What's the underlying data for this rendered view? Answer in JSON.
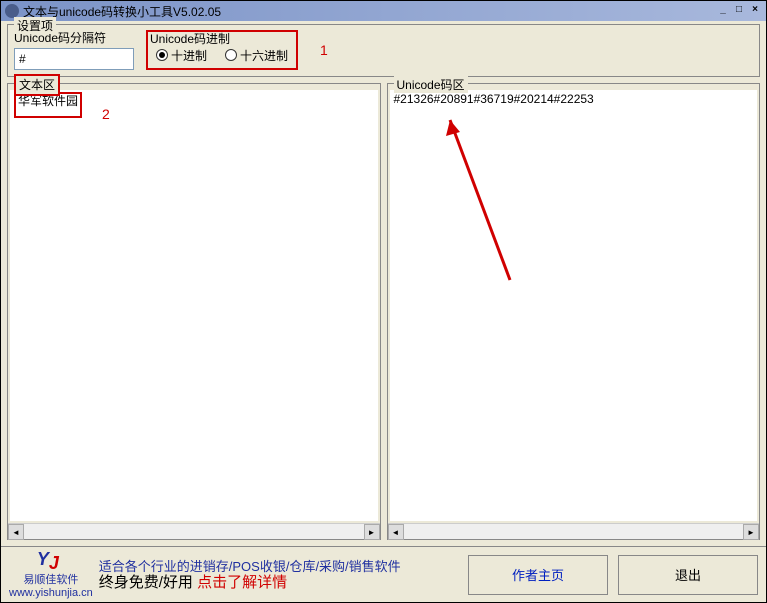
{
  "titlebar": {
    "title": "文本与unicode码转换小工具V5.02.05"
  },
  "settings": {
    "group_label": "设置项",
    "separator_label": "Unicode码分隔符",
    "separator_value": "#",
    "radix_label": "Unicode码进制",
    "radio_decimal": "十进制",
    "radio_hex": "十六进制",
    "radix_selected": "decimal"
  },
  "annotations": {
    "one": "1",
    "two": "2"
  },
  "panes": {
    "text_label": "文本区",
    "text_content": "华军软件园",
    "code_label": "Unicode码区",
    "code_content": "#21326#20891#36719#20214#22253"
  },
  "footer": {
    "logo_line1": "适合各个行业的进销存/POS收银/仓库/采购/销售软件",
    "logo_sub": "易顺佳软件",
    "logo_line2_black": "终身免费/好用 ",
    "logo_line2_red": "点击了解详情",
    "logo_url": "www.yishunjia.cn",
    "author_btn": "作者主页",
    "exit_btn": "退出"
  }
}
